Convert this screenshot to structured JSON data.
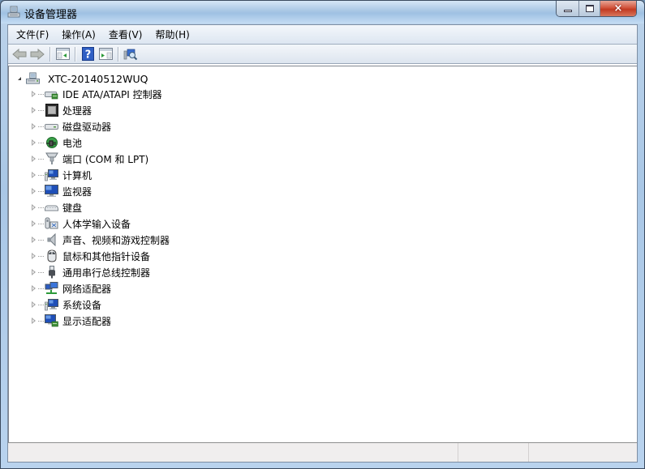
{
  "window": {
    "title": "设备管理器",
    "controls": {
      "minimize": "minimize",
      "maximize": "maximize",
      "close": "×"
    }
  },
  "menubar": {
    "items": [
      {
        "label": "文件(F)"
      },
      {
        "label": "操作(A)"
      },
      {
        "label": "查看(V)"
      },
      {
        "label": "帮助(H)"
      }
    ]
  },
  "toolbar": {
    "buttons": [
      {
        "name": "back",
        "icon": "arrow-left-icon"
      },
      {
        "name": "forward",
        "icon": "arrow-right-icon"
      },
      {
        "name": "show-hide-console-tree",
        "icon": "console-tree-icon"
      },
      {
        "name": "help",
        "icon": "help-icon",
        "glyph": "?"
      },
      {
        "name": "show-hide-action-pane",
        "icon": "action-pane-icon"
      },
      {
        "name": "scan-hardware",
        "icon": "scan-hardware-icon"
      }
    ]
  },
  "tree": {
    "root": {
      "label": "XTC-20140512WUQ",
      "icon": "computer-icon",
      "expanded": true
    },
    "items": [
      {
        "label": "IDE ATA/ATAPI 控制器",
        "icon": "ide-controller-icon"
      },
      {
        "label": "处理器",
        "icon": "processor-icon"
      },
      {
        "label": "磁盘驱动器",
        "icon": "disk-drive-icon"
      },
      {
        "label": "电池",
        "icon": "battery-icon"
      },
      {
        "label": "端口 (COM 和 LPT)",
        "icon": "port-icon"
      },
      {
        "label": "计算机",
        "icon": "computer-monitor-icon"
      },
      {
        "label": "监视器",
        "icon": "monitor-icon"
      },
      {
        "label": "键盘",
        "icon": "keyboard-icon"
      },
      {
        "label": "人体学输入设备",
        "icon": "hid-icon"
      },
      {
        "label": "声音、视频和游戏控制器",
        "icon": "speaker-icon"
      },
      {
        "label": "鼠标和其他指针设备",
        "icon": "mouse-icon"
      },
      {
        "label": "通用串行总线控制器",
        "icon": "usb-icon"
      },
      {
        "label": "网络适配器",
        "icon": "network-adapter-icon"
      },
      {
        "label": "系统设备",
        "icon": "system-device-icon"
      },
      {
        "label": "显示适配器",
        "icon": "display-adapter-icon"
      }
    ]
  },
  "colors": {
    "titlebar": "#a8c6e4",
    "close_button": "#c23a22",
    "client_bg": "#ffffff",
    "statusbar_bg": "#f0eeee"
  }
}
